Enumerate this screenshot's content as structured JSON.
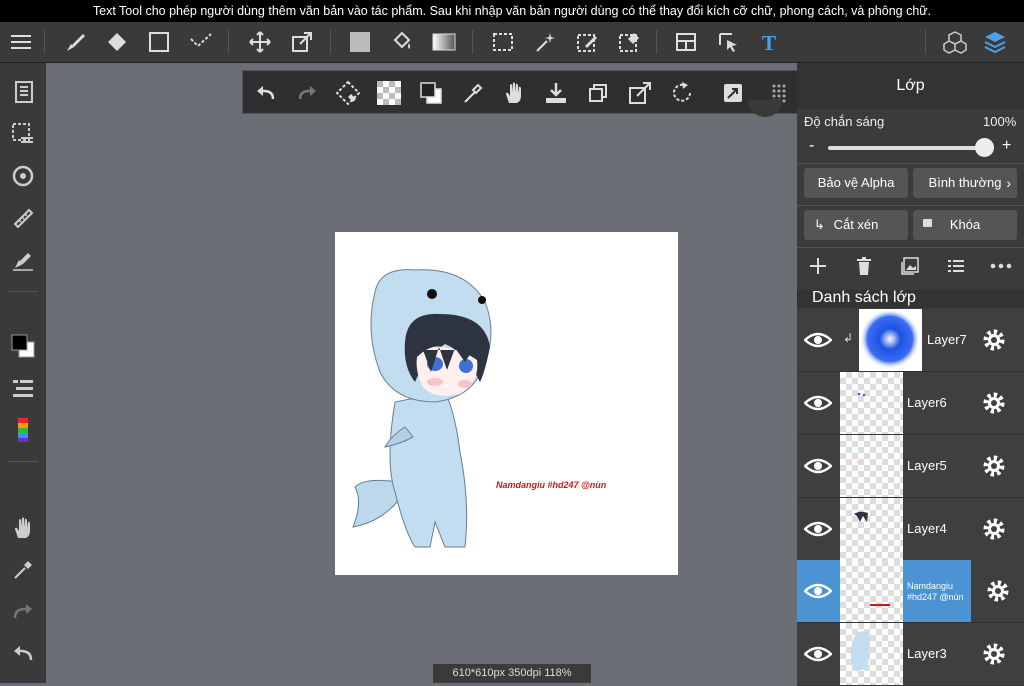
{
  "status_hint": "Text Tool cho phép người dùng thêm văn bản vào tác phẩm. Sau khi nhập văn bản người dùng có thể thay đổi kích cỡ chữ, phong cách, và phông chữ.",
  "canvas_info": "610*610px 350dpi 118%",
  "canvas": {
    "watermark": "Namdangiu #hd247 @nùn"
  },
  "panel": {
    "title": "Lớp",
    "opacity_label": "Độ chắn sáng",
    "opacity_value": "100%",
    "opacity_fraction": 1.0,
    "minus": "-",
    "plus": "+",
    "protect_alpha": "Bảo vệ Alpha",
    "blend_mode": "Bình thường",
    "clip": "Cắt xén",
    "lock": "Khóa",
    "layer_list_title": "Danh sách lớp",
    "layers": [
      {
        "label": "Layer7"
      },
      {
        "label": "Layer6"
      },
      {
        "label": "Layer5"
      },
      {
        "label": "Layer4"
      },
      {
        "label": "Namdangiu #hd247 @nùn"
      },
      {
        "label": "Layer3"
      }
    ]
  },
  "colors": {
    "accent": "#4b93d3",
    "text_tool": "#4aa3e8"
  }
}
